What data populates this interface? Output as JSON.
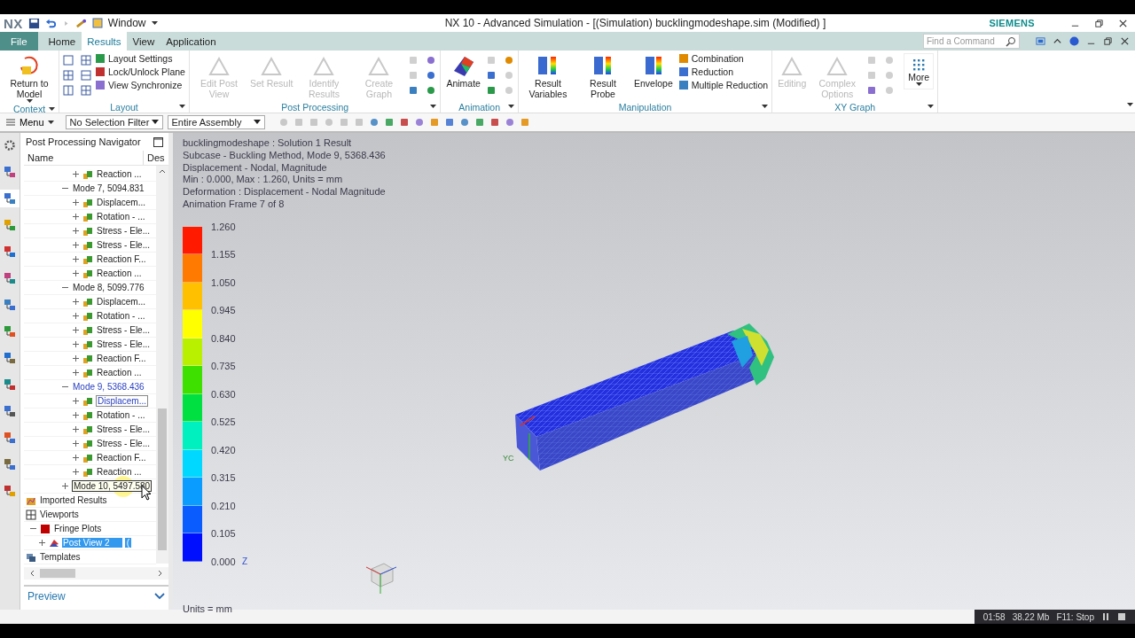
{
  "title_bar": {
    "logo": "NX",
    "quick_menu": "Window",
    "title": "NX 10 - Advanced Simulation - [(Simulation) bucklingmodeshape.sim (Modified) ]",
    "brand": "SIEMENS"
  },
  "ribbon_tabs": [
    {
      "label": "File",
      "kind": "file",
      "selected": false
    },
    {
      "label": "Home",
      "kind": "tab",
      "selected": false
    },
    {
      "label": "Results",
      "kind": "tab",
      "selected": true
    },
    {
      "label": "View",
      "kind": "tab",
      "selected": false
    },
    {
      "label": "Application",
      "kind": "tab",
      "selected": false
    }
  ],
  "command_search": {
    "placeholder": "Find a Command"
  },
  "ribbon_groups": [
    {
      "label": "Context",
      "big": [
        {
          "label": "Return to Model",
          "disabled": false,
          "dropdown": true
        }
      ]
    },
    {
      "label": "Layout",
      "small": [
        {
          "label": "Layout Settings"
        },
        {
          "label": "Lock/Unlock Plane"
        },
        {
          "label": "View Synchronize"
        }
      ],
      "tools": [
        {
          "disabled": false
        },
        {
          "disabled": false
        },
        {
          "disabled": false
        },
        {
          "disabled": false
        },
        {
          "disabled": false
        },
        {
          "disabled": false
        }
      ]
    },
    {
      "label": "Post Processing",
      "big": [
        {
          "label": "Edit Post View",
          "disabled": true,
          "dropdown": false
        },
        {
          "label": "Set Result",
          "disabled": true,
          "dropdown": false
        },
        {
          "label": "Identify Results",
          "disabled": true,
          "dropdown": false
        },
        {
          "label": "Create Graph",
          "disabled": true,
          "dropdown": false
        }
      ],
      "tools": [
        {
          "disabled": true
        },
        {
          "disabled": false
        },
        {
          "disabled": true
        },
        {
          "disabled": false
        },
        {
          "disabled": false
        },
        {
          "disabled": false
        }
      ]
    },
    {
      "label": "Animation",
      "big": [
        {
          "label": "Animate",
          "disabled": false,
          "dropdown": false
        }
      ],
      "tools": [
        {
          "disabled": true
        },
        {
          "disabled": false
        },
        {
          "disabled": false
        },
        {
          "disabled": true
        },
        {
          "disabled": false
        },
        {
          "disabled": true
        }
      ]
    },
    {
      "label": "Manipulation",
      "big": [
        {
          "label": "Result Variables",
          "disabled": false,
          "dropdown": false
        },
        {
          "label": "Result Probe",
          "disabled": false,
          "dropdown": false
        },
        {
          "label": "Envelope",
          "disabled": false,
          "dropdown": false
        }
      ],
      "small": [
        {
          "label": "Combination"
        },
        {
          "label": "Reduction"
        },
        {
          "label": "Multiple Reduction"
        }
      ]
    },
    {
      "label": "XY Graph",
      "big": [
        {
          "label": "Editing",
          "disabled": true,
          "dropdown": false
        },
        {
          "label": "Complex Options",
          "disabled": true,
          "dropdown": false
        }
      ],
      "tools": [
        {
          "disabled": true
        },
        {
          "disabled": true
        },
        {
          "disabled": true
        },
        {
          "disabled": true
        },
        {
          "disabled": false
        },
        {
          "disabled": true
        }
      ]
    }
  ],
  "more_button": "More",
  "toolbar": {
    "menu": "Menu",
    "selection_filter": "No Selection Filter",
    "scope": "Entire Assembly"
  },
  "resource_tabs": [
    {
      "selected": false
    },
    {
      "selected": false
    },
    {
      "selected": true
    },
    {
      "selected": false
    },
    {
      "selected": false
    },
    {
      "selected": false
    },
    {
      "selected": false
    },
    {
      "selected": false
    },
    {
      "selected": false
    },
    {
      "selected": false
    },
    {
      "selected": false
    },
    {
      "selected": false
    },
    {
      "selected": false
    },
    {
      "selected": false
    }
  ],
  "navigator": {
    "title": "Post Processing Navigator",
    "columns": [
      "Name",
      "Des"
    ],
    "tree": [
      {
        "kind": "result",
        "label": "Reaction ...",
        "expanded": false,
        "current": false,
        "selected": false
      },
      {
        "kind": "mode",
        "label": "Mode 7, 5094.831",
        "expanded": true,
        "current": false,
        "hovered": false,
        "selected": false,
        "children": [
          {
            "kind": "result",
            "label": "Displacem...",
            "expanded": false,
            "current": false,
            "selected": false
          },
          {
            "kind": "result",
            "label": "Rotation - ...",
            "expanded": false,
            "current": false,
            "selected": false
          },
          {
            "kind": "result",
            "label": "Stress - Ele...",
            "expanded": false,
            "current": false,
            "selected": false
          },
          {
            "kind": "result",
            "label": "Stress - Ele...",
            "expanded": false,
            "current": false,
            "selected": false
          },
          {
            "kind": "result",
            "label": "Reaction F...",
            "expanded": false,
            "current": false,
            "selected": false
          },
          {
            "kind": "result",
            "label": "Reaction ...",
            "expanded": false,
            "current": false,
            "selected": false
          }
        ]
      },
      {
        "kind": "mode",
        "label": "Mode 8, 5099.776",
        "expanded": true,
        "current": false,
        "hovered": false,
        "selected": false,
        "children": [
          {
            "kind": "result",
            "label": "Displacem...",
            "expanded": false,
            "current": false,
            "selected": false
          },
          {
            "kind": "result",
            "label": "Rotation - ...",
            "expanded": false,
            "current": false,
            "selected": false
          },
          {
            "kind": "result",
            "label": "Stress - Ele...",
            "expanded": false,
            "current": false,
            "selected": false
          },
          {
            "kind": "result",
            "label": "Stress - Ele...",
            "expanded": false,
            "current": false,
            "selected": false
          },
          {
            "kind": "result",
            "label": "Reaction F...",
            "expanded": false,
            "current": false,
            "selected": false
          },
          {
            "kind": "result",
            "label": "Reaction ...",
            "expanded": false,
            "current": false,
            "selected": false
          }
        ]
      },
      {
        "kind": "mode",
        "label": "Mode 9, 5368.436",
        "expanded": true,
        "current": true,
        "hovered": false,
        "selected": false,
        "children": [
          {
            "kind": "result",
            "label": "Displacem...",
            "expanded": false,
            "current": true,
            "selected": false
          },
          {
            "kind": "result",
            "label": "Rotation - ...",
            "expanded": false,
            "current": false,
            "selected": false
          },
          {
            "kind": "result",
            "label": "Stress - Ele...",
            "expanded": false,
            "current": false,
            "selected": false
          },
          {
            "kind": "result",
            "label": "Stress - Ele...",
            "expanded": false,
            "current": false,
            "selected": false
          },
          {
            "kind": "result",
            "label": "Reaction F...",
            "expanded": false,
            "current": false,
            "selected": false
          },
          {
            "kind": "result",
            "label": "Reaction ...",
            "expanded": false,
            "current": false,
            "selected": false
          }
        ]
      },
      {
        "kind": "mode",
        "label": "Mode 10, 5497.580",
        "expanded": false,
        "current": false,
        "hovered": true,
        "selected": false
      },
      {
        "kind": "folder",
        "label": "Imported Results",
        "current": false,
        "selected": false
      },
      {
        "kind": "viewports",
        "label": "Viewports",
        "current": false,
        "selected": false
      },
      {
        "kind": "fringe",
        "label": "Fringe Plots",
        "expanded": true,
        "current": false,
        "selected": false,
        "children": [
          {
            "kind": "view",
            "label": "Post View 2",
            "description": "(",
            "expanded": false,
            "current": false,
            "selected": true
          }
        ]
      },
      {
        "kind": "templates",
        "label": "Templates",
        "current": false,
        "selected": false
      }
    ],
    "preview": "Preview"
  },
  "viewport": {
    "info": [
      "bucklingmodeshape : Solution 1 Result",
      "Subcase - Buckling Method, Mode 9, 5368.436",
      "Displacement - Nodal, Magnitude",
      "Min : 0.000, Max : 1.260, Units = mm",
      "Deformation : Displacement - Nodal Magnitude",
      "Animation Frame 7 of 8"
    ],
    "legend_values": [
      "1.260",
      "1.155",
      "1.050",
      "0.945",
      "0.840",
      "0.735",
      "0.630",
      "0.525",
      "0.420",
      "0.315",
      "0.210",
      "0.105",
      "0.000"
    ],
    "units": "Units = mm",
    "triad_label": "Z",
    "model_label": "YC"
  },
  "recorder": {
    "time": "01:58",
    "size": "38.22 Mb",
    "hint": "F11: Stop"
  }
}
